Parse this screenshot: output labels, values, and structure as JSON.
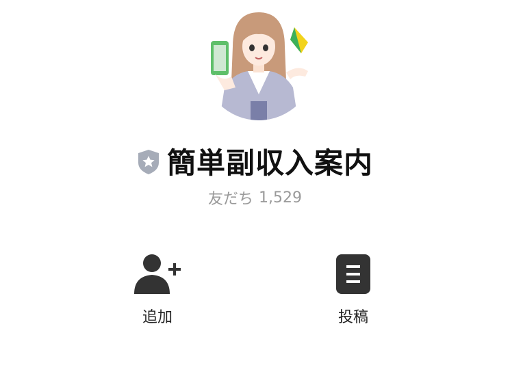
{
  "profile": {
    "account_name": "簡単副収入案内",
    "friends_label": "友だち",
    "friends_count": "1,529",
    "badge_icon": "shield-star-icon",
    "avatar_icon": "woman-with-phone-illustration"
  },
  "actions": {
    "add": {
      "label": "追加",
      "icon": "add-friend-icon"
    },
    "post": {
      "label": "投稿",
      "icon": "post-list-icon"
    }
  },
  "colors": {
    "badge": "#a6acb8",
    "icon": "#333333",
    "muted_text": "#9a9a9a"
  }
}
